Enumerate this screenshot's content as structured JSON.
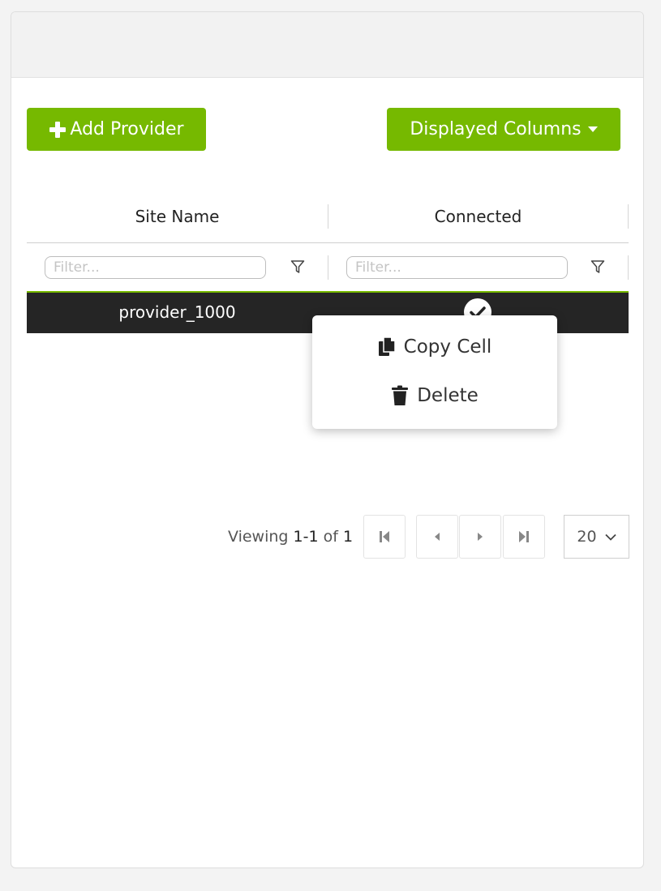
{
  "toolbar": {
    "add_provider_label": "Add Provider",
    "displayed_columns_label": "Displayed Columns"
  },
  "grid": {
    "columns": [
      {
        "label": "Site Name",
        "filter_placeholder": "Filter..."
      },
      {
        "label": "Connected",
        "filter_placeholder": "Filter..."
      }
    ],
    "rows": [
      {
        "site_name": "provider_1000",
        "connected": true
      }
    ]
  },
  "context_menu": {
    "items": [
      {
        "label": "Copy Cell",
        "icon": "copy-icon"
      },
      {
        "label": "Delete",
        "icon": "trash-icon"
      }
    ]
  },
  "pagination": {
    "viewing_prefix": "Viewing",
    "range": "1-1",
    "of_label": "of",
    "total": "1",
    "page_size": "20"
  },
  "colors": {
    "accent": "#76b900",
    "selected_row": "#252525"
  }
}
